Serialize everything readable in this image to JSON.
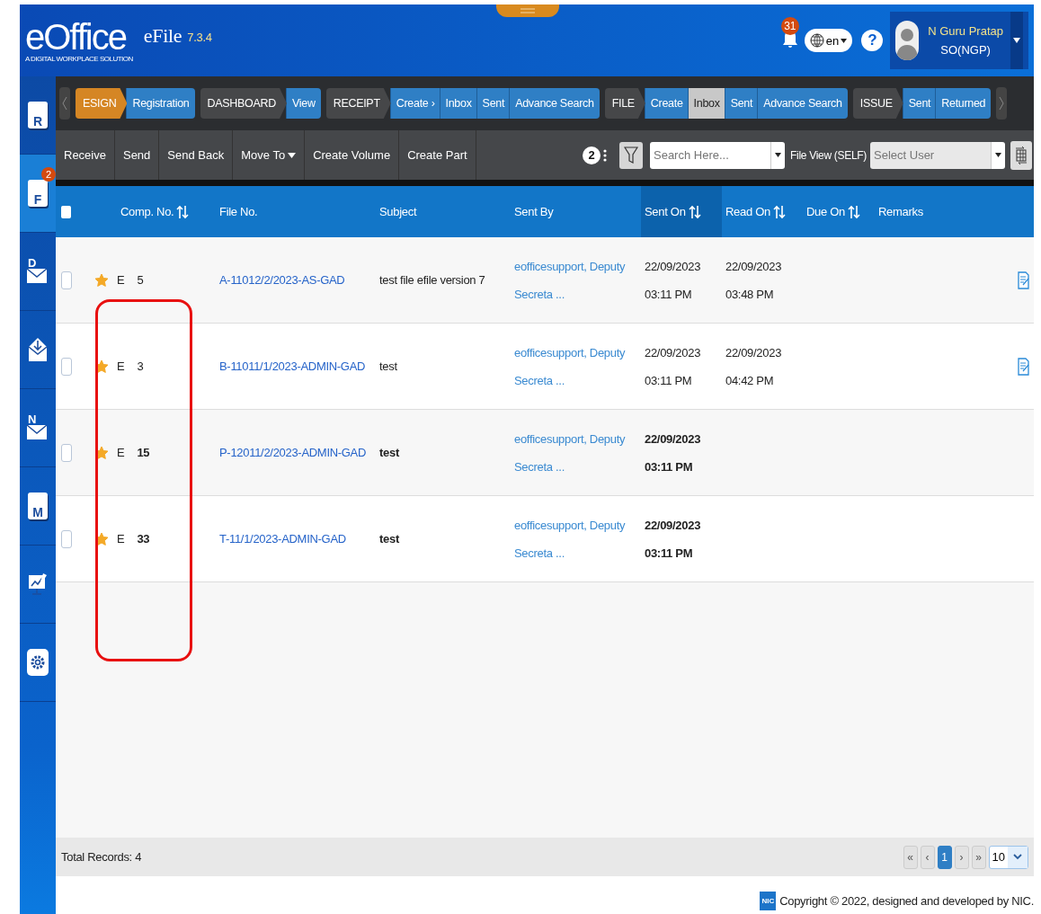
{
  "header": {
    "logo": "eOffice",
    "tagline": "A DIGITAL WORKPLACE SOLUTION",
    "app": "eFile",
    "version": "7.3.4",
    "notifications": "31",
    "language": "en",
    "help": "?",
    "user": {
      "name": "N Guru Pratap",
      "role": "SO(NGP)"
    }
  },
  "sidebar": {
    "items": [
      {
        "kind": "doc",
        "letter": "R",
        "selected": false
      },
      {
        "kind": "doc",
        "letter": "F",
        "selected": true,
        "badge": "2"
      },
      {
        "kind": "mail",
        "letter": "D",
        "selected": false
      },
      {
        "kind": "inbox",
        "selected": false
      },
      {
        "kind": "mail",
        "letter": "N",
        "selected": false
      },
      {
        "kind": "doc",
        "letter": "M",
        "selected": false
      },
      {
        "kind": "chart",
        "selected": false
      },
      {
        "kind": "gear",
        "selected": false
      }
    ]
  },
  "nav": {
    "groups": [
      {
        "label": "ESIGN",
        "highlight": true,
        "items": [
          {
            "label": "Registration",
            "selected": false
          }
        ]
      },
      {
        "label": "DASHBOARD",
        "highlight": false,
        "items": [
          {
            "label": "View",
            "selected": false
          }
        ]
      },
      {
        "label": "RECEIPT",
        "highlight": false,
        "items": [
          {
            "label": "Create ›",
            "selected": false
          },
          {
            "label": "Inbox",
            "selected": false
          },
          {
            "label": "Sent",
            "selected": false
          },
          {
            "label": "Advance Search",
            "selected": false
          }
        ]
      },
      {
        "label": "FILE",
        "highlight": false,
        "items": [
          {
            "label": "Create",
            "selected": false
          },
          {
            "label": "Inbox",
            "selected": true
          },
          {
            "label": "Sent",
            "selected": false
          },
          {
            "label": "Advance Search",
            "selected": false
          }
        ]
      },
      {
        "label": "ISSUE",
        "highlight": false,
        "items": [
          {
            "label": "Sent",
            "selected": false
          },
          {
            "label": "Returned",
            "selected": false
          }
        ]
      }
    ]
  },
  "toolbar": {
    "buttons": [
      {
        "label": "Receive",
        "kind": "plain"
      },
      {
        "label": "Send",
        "kind": "plain"
      },
      {
        "label": "Send Back",
        "kind": "plain"
      },
      {
        "label": "Move To",
        "kind": "dropdown"
      },
      {
        "label": "Create Volume",
        "kind": "plain"
      },
      {
        "label": "Create Part",
        "kind": "plain"
      }
    ],
    "count": "2",
    "search": {
      "placeholder": "Search Here..."
    },
    "file_view_label": "File View (SELF)",
    "user_select": {
      "placeholder": "Select User"
    }
  },
  "table": {
    "columns": [
      {
        "label": "Comp. No.",
        "sortable": true,
        "active": false
      },
      {
        "label": "File No.",
        "sortable": false,
        "active": false
      },
      {
        "label": "Subject",
        "sortable": false,
        "active": false
      },
      {
        "label": "Sent By",
        "sortable": false,
        "active": false
      },
      {
        "label": "Sent On",
        "sortable": true,
        "active": true
      },
      {
        "label": "Read On",
        "sortable": true,
        "active": false
      },
      {
        "label": "Due On",
        "sortable": true,
        "active": false
      },
      {
        "label": "Remarks",
        "sortable": false,
        "active": false
      }
    ],
    "all_checked": false,
    "rows": [
      {
        "checked": false,
        "starred": true,
        "unread": false,
        "type": "E",
        "comp_no": "5",
        "file_no": "A-11012/2/2023-AS-GAD",
        "subject": "test file efile version 7",
        "sent_by": "eofficesupport, Deputy Secreta ...",
        "sent_on": [
          "22/09/2023",
          "03:11 PM"
        ],
        "read_on": [
          "22/09/2023",
          "03:48 PM"
        ],
        "has_remarks": true
      },
      {
        "checked": false,
        "starred": true,
        "unread": false,
        "type": "E",
        "comp_no": "3",
        "file_no": "B-11011/1/2023-ADMIN-GAD",
        "subject": "test",
        "sent_by": "eofficesupport, Deputy Secreta ...",
        "sent_on": [
          "22/09/2023",
          "03:11 PM"
        ],
        "read_on": [
          "22/09/2023",
          "04:42 PM"
        ],
        "has_remarks": true
      },
      {
        "checked": false,
        "starred": true,
        "unread": true,
        "type": "E",
        "comp_no": "15",
        "file_no": "P-12011/2/2023-ADMIN-GAD",
        "subject": "test",
        "sent_by": "eofficesupport, Deputy Secreta ...",
        "sent_on": [
          "22/09/2023",
          "03:11 PM"
        ],
        "has_remarks": false
      },
      {
        "checked": false,
        "starred": true,
        "unread": true,
        "type": "E",
        "comp_no": "33",
        "file_no": "T-11/1/2023-ADMIN-GAD",
        "subject": "test",
        "sent_by": "eofficesupport, Deputy Secreta ...",
        "sent_on": [
          "22/09/2023",
          "03:11 PM"
        ],
        "has_remarks": false
      }
    ]
  },
  "footer": {
    "total": "Total Records: 4",
    "pages": [
      {
        "label": "«",
        "selected": false
      },
      {
        "label": "‹",
        "selected": false
      },
      {
        "label": "1",
        "selected": true
      },
      {
        "label": "›",
        "selected": false
      },
      {
        "label": "»",
        "selected": false
      }
    ],
    "page_size": "10"
  },
  "copyright": {
    "logo": "NIC",
    "text": "Copyright © 2022, designed and developed by NIC."
  }
}
